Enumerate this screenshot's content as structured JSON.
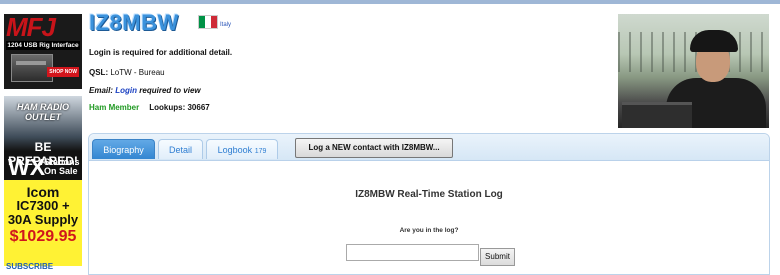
{
  "ads": {
    "mfj": {
      "logo": "MFJ",
      "subtitle": "1204 USB Rig Interface",
      "cta": "SHOP NOW"
    },
    "hro": {
      "brand": "HAM RADIO OUTLET",
      "line1": "BE PREPARED!",
      "wx": "WX",
      "stations": "Stations",
      "sale": "On Sale"
    },
    "icom": {
      "line1": "Icom",
      "line2": "IC7300 +",
      "line3": "30A Supply",
      "price": "$1029.95"
    },
    "subscribe": "SUBSCRIBE"
  },
  "profile": {
    "callsign": "IZ8MBW",
    "country": "Italy",
    "flag_colors": [
      "#009246",
      "#ffffff",
      "#ce2b37"
    ],
    "login_required": "Login is required for additional detail.",
    "qsl_label": "QSL:",
    "qsl_value": "LoTW - Bureau",
    "email_label": "Email:",
    "email_link": "Login",
    "email_suffix": "required to view",
    "member": "Ham Member",
    "lookups_label": "Lookups:",
    "lookups_value": "30667"
  },
  "tabs": [
    {
      "label": "Biography",
      "active": true
    },
    {
      "label": "Detail",
      "active": false
    },
    {
      "label": "Logbook",
      "count": "179",
      "active": false
    }
  ],
  "log_button": "Log a NEW contact with IZ8MBW...",
  "logbook": {
    "title": "IZ8MBW Real-Time Station Log",
    "prompt": "Are you in the log?",
    "input_value": "",
    "submit": "Submit"
  },
  "colors": {
    "accent": "#3b92dc",
    "member": "#219a23",
    "link": "#1b41c2"
  }
}
